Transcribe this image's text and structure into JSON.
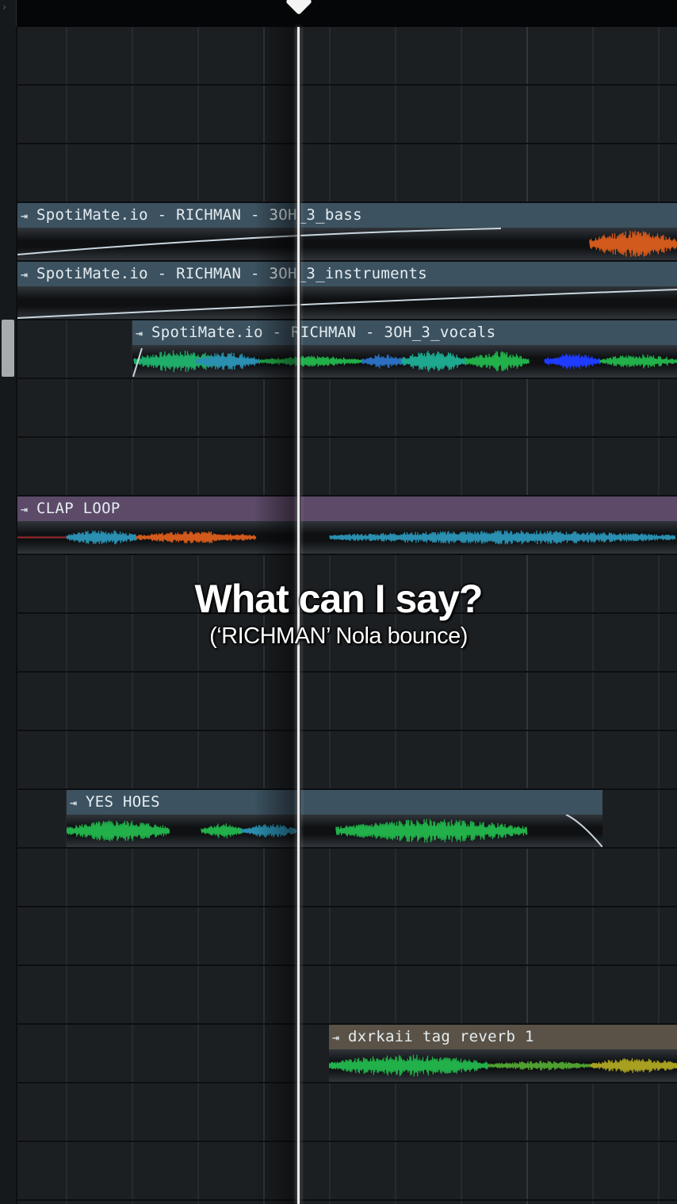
{
  "clips": [
    {
      "id": "bass",
      "name": "SpotiMate.io - RICHMAN - 3OH_3_bass"
    },
    {
      "id": "instruments",
      "name": "SpotiMate.io - RICHMAN - 3OH_3_instruments"
    },
    {
      "id": "vocals",
      "name": "SpotiMate.io - RICHMAN - 3OH_3_vocals"
    },
    {
      "id": "clap",
      "name": "CLAP LOOP"
    },
    {
      "id": "yes",
      "name": "YES HOES"
    },
    {
      "id": "tag",
      "name": "dxrkaii tag reverb 1"
    }
  ],
  "caption": {
    "title": "What can I say?",
    "subtitle": "(‘RICHMAN’ Nola bounce)"
  },
  "icons": {
    "clip": "play-arrow-icon"
  },
  "colors": {
    "clip_header": "#3c5260",
    "clap_header": "#5c4a68",
    "tag_header": "#5a5246",
    "waveform_green": "#22b04a",
    "waveform_orange": "#d25a1c",
    "waveform_blue": "#1e3cff",
    "playhead": "#e8eaec"
  }
}
